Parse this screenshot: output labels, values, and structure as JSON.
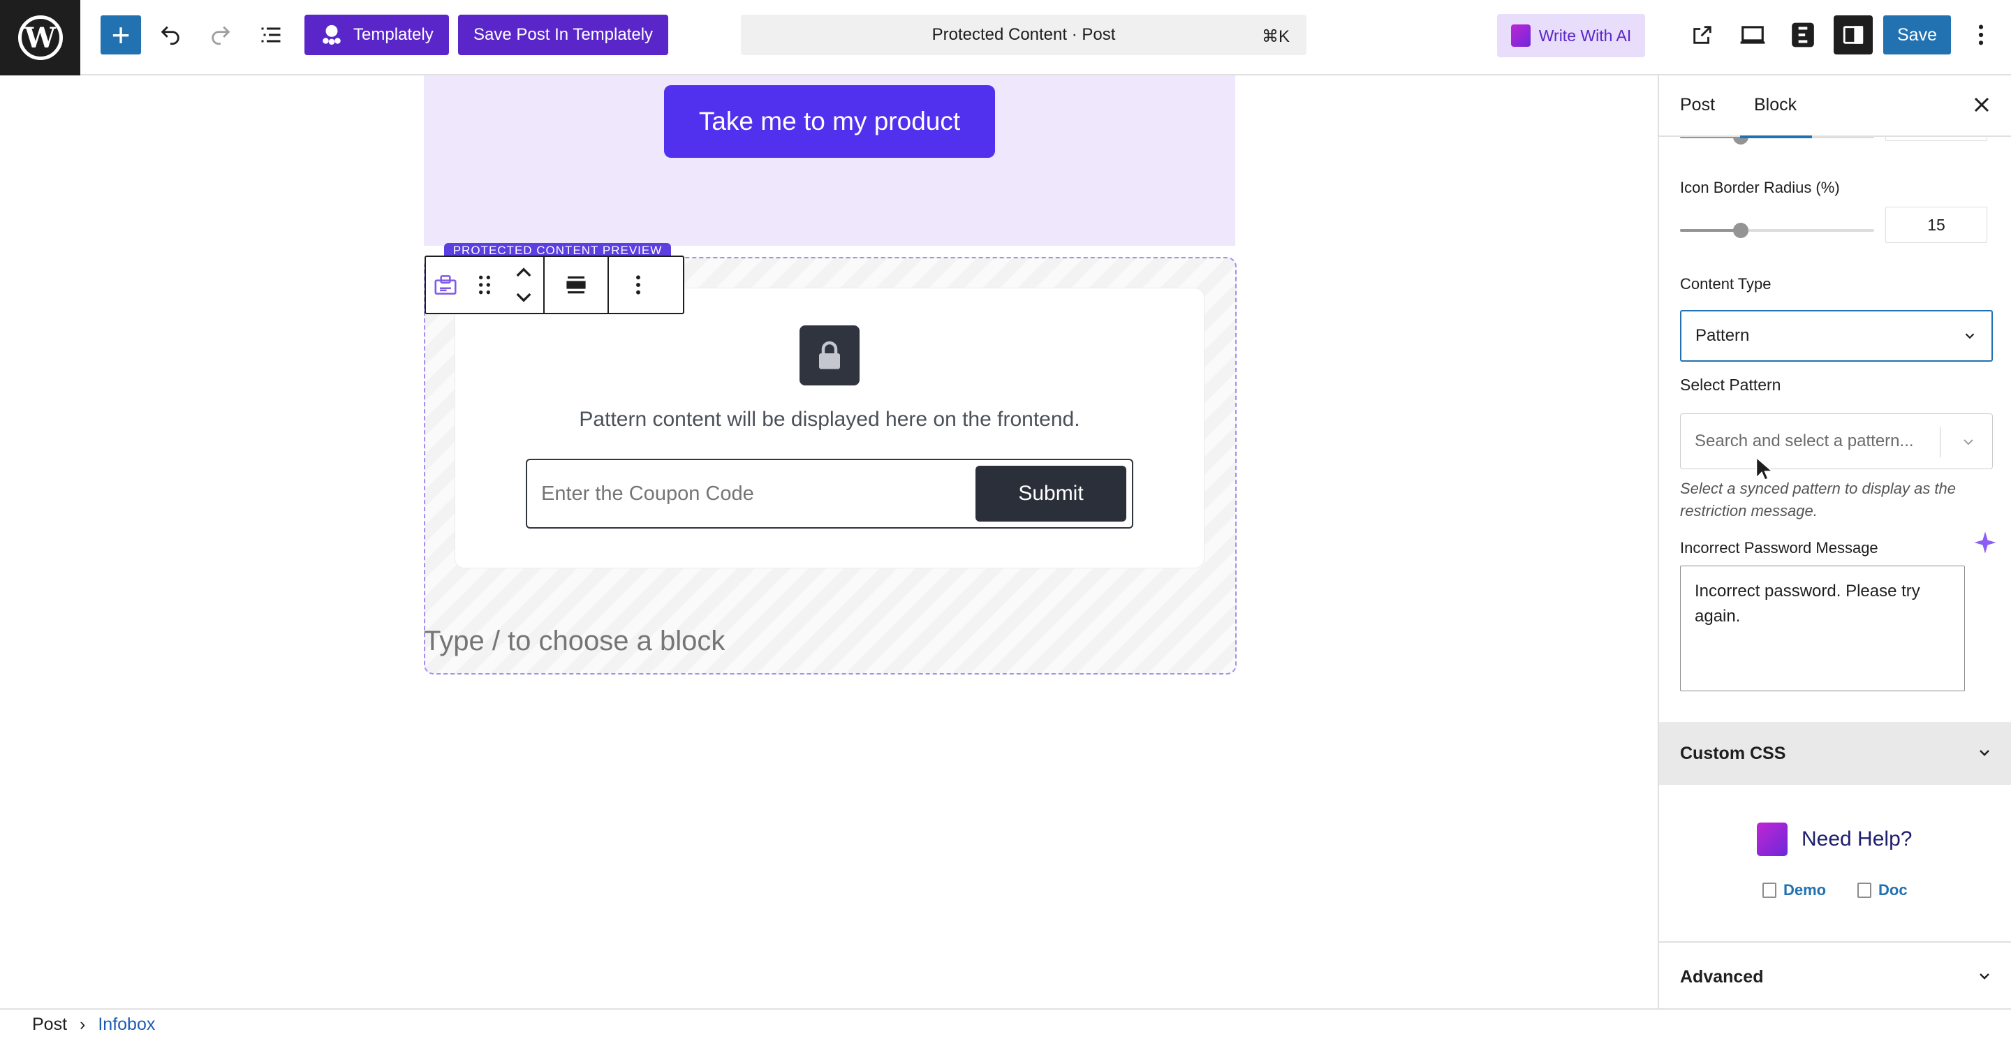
{
  "toolbar": {
    "add_label": "+",
    "templately_label": "Templately",
    "save_in_templately_label": "Save Post In Templately",
    "command_title": "Protected Content · Post",
    "command_shortcut": "⌘K",
    "write_ai_label": "Write With AI",
    "save_label": "Save",
    "icons": [
      "wordpress-logo",
      "add-icon",
      "undo-icon",
      "redo-icon",
      "list-view-icon",
      "templately-icon",
      "view-post-icon",
      "preview-device-icon",
      "essential-blocks-icon",
      "settings-icon",
      "more-options-icon"
    ]
  },
  "canvas": {
    "cta_label": "Take me to my product",
    "preview_tag": "PROTECTED CONTENT PREVIEW",
    "pattern_note": "Pattern content will be displayed here on the frontend.",
    "coupon_placeholder": "Enter the Coupon Code",
    "submit_label": "Submit",
    "type_block_placeholder": "Type / to choose a block"
  },
  "sidebar": {
    "tabs": [
      {
        "label": "Post",
        "active": false
      },
      {
        "label": "Block",
        "active": true
      }
    ],
    "icon_border_radius_label": "Icon Border Radius (%)",
    "icon_border_radius_value": "15",
    "content_type_label": "Content Type",
    "content_type_value": "Pattern",
    "select_pattern_label": "Select Pattern",
    "select_pattern_placeholder": "Search and select a pattern...",
    "select_pattern_help": "Select a synced pattern to display as the restriction message.",
    "incorrect_password_label": "Incorrect Password Message",
    "incorrect_password_value": "Incorrect password. Please try again.",
    "custom_css_label": "Custom CSS",
    "need_help_label": "Need Help?",
    "demo_label": "Demo",
    "doc_label": "Doc",
    "advanced_label": "Advanced"
  },
  "breadcrumb": {
    "root": "Post",
    "separator": "›",
    "current": "Infobox"
  },
  "colors": {
    "accent_blue": "#2271b1",
    "templately_purple": "#5b26c9",
    "cta_purple": "#5131ee",
    "hero_bg": "#efe8fd"
  }
}
